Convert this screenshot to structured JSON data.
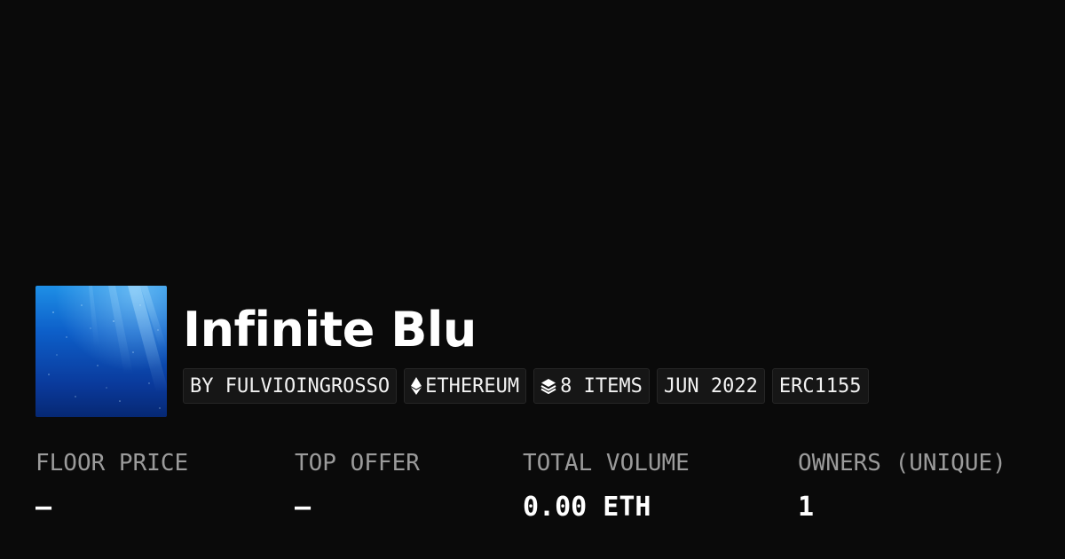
{
  "collection": {
    "title": "Infinite Blu",
    "image_alt": "Underwater blue light rays artwork"
  },
  "badges": {
    "creator": "BY FULVIOINGROSSO",
    "chain": "ETHEREUM",
    "chain_icon": "ethereum-icon",
    "items": "8 ITEMS",
    "items_icon": "layers-icon",
    "date": "JUN 2022",
    "standard": "ERC1155"
  },
  "stats": {
    "floor_price": {
      "label": "FLOOR PRICE",
      "value": "–"
    },
    "top_offer": {
      "label": "TOP OFFER",
      "value": "–"
    },
    "total_volume": {
      "label": "TOTAL VOLUME",
      "value": "0.00 ETH"
    },
    "owners": {
      "label": "OWNERS (UNIQUE)",
      "value": "1"
    }
  },
  "colors": {
    "background": "#0a0a0a",
    "badge_background": "#161616",
    "label": "#9b9b9b",
    "text": "#ffffff"
  }
}
